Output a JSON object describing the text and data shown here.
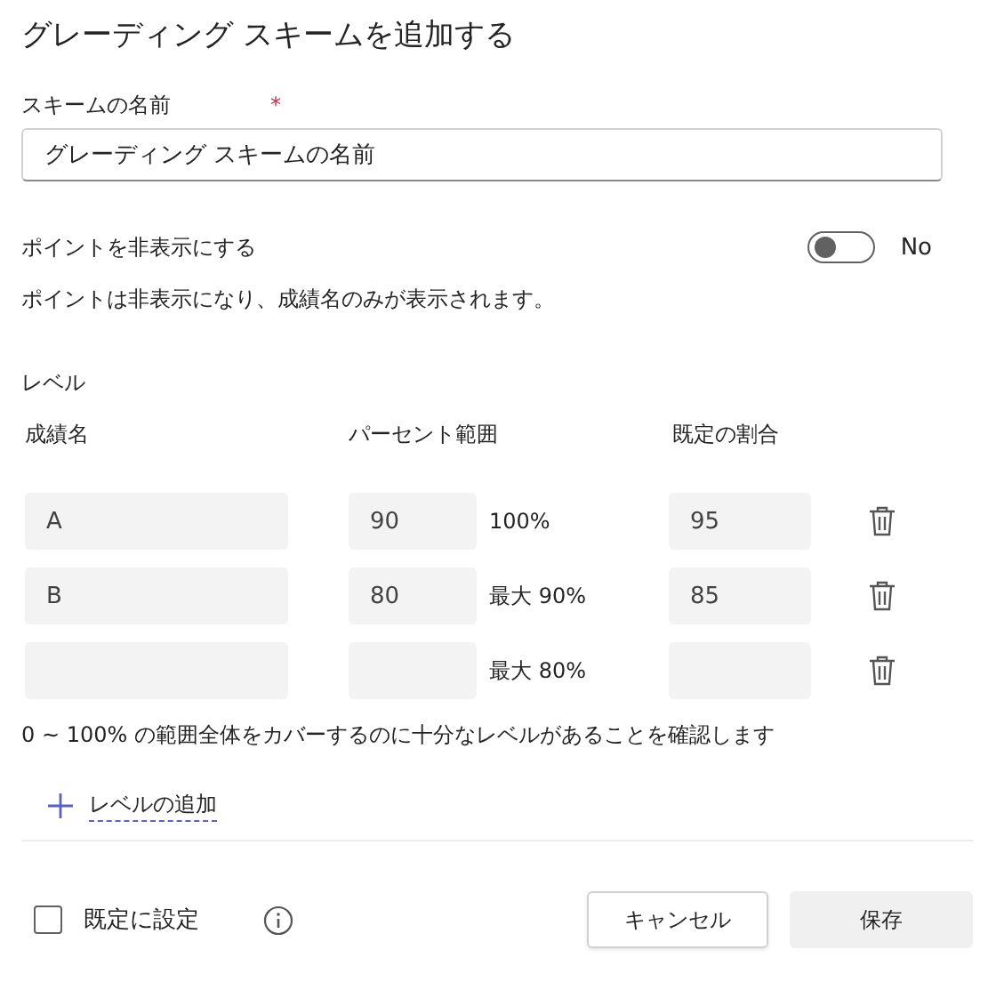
{
  "dialog": {
    "title": "グレーディング スキームを追加する"
  },
  "scheme_name": {
    "label": "スキームの名前",
    "required_mark": "*",
    "value": "グレーディング スキームの名前"
  },
  "hide_points": {
    "label": "ポイントを非表示にする",
    "on": false,
    "state_text": "No",
    "description": "ポイントは非表示になり、成績名のみが表示されます。"
  },
  "levels": {
    "title": "レベル",
    "columns": [
      "成績名",
      "パーセント範囲",
      "既定の割合"
    ],
    "rows": [
      {
        "grade": "A",
        "min_percent": "90",
        "range": "100%",
        "default_percent": "95"
      },
      {
        "grade": "B",
        "min_percent": "80",
        "range": "最大 90%",
        "default_percent": "85"
      },
      {
        "range": "最大 80%"
      }
    ],
    "note": "0 ~ 100% の範囲全体をカバーするのに十分なレベルがあることを確認します",
    "add_label": "レベルの追加"
  },
  "footer": {
    "set_default": {
      "label": "既定に設定",
      "checked": false
    },
    "buttons": [
      "キャンセル",
      "保存"
    ]
  }
}
